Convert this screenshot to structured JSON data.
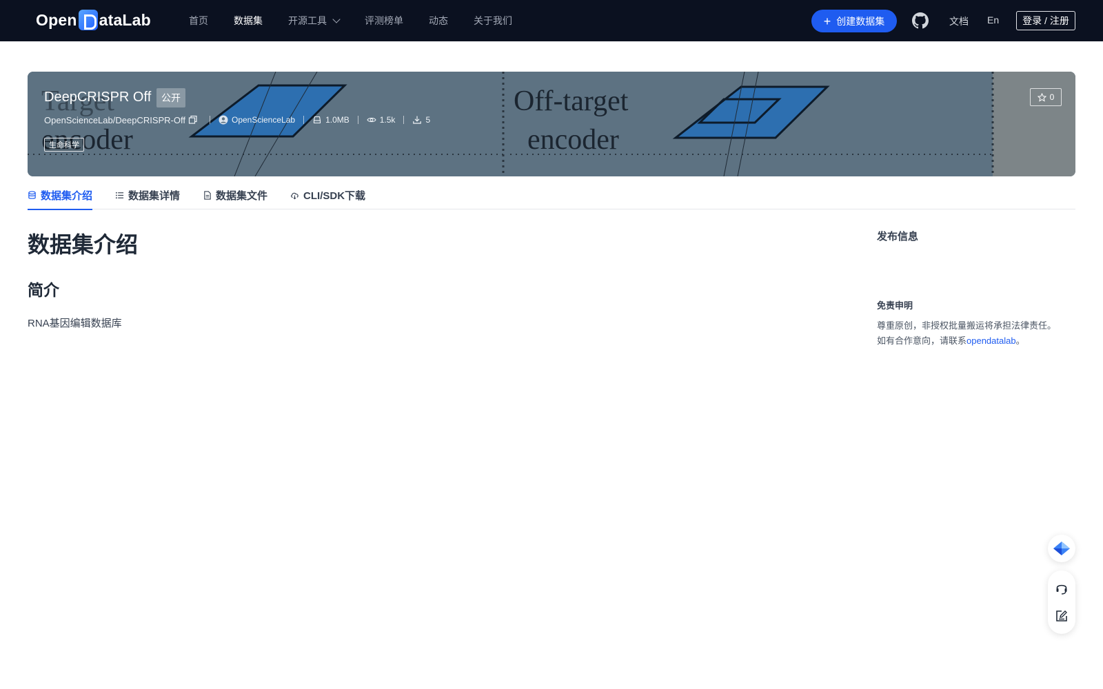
{
  "brand": {
    "logo_text_left": "Open",
    "logo_text_right": "ataLab"
  },
  "nav": {
    "items": [
      {
        "label": "首页"
      },
      {
        "label": "数据集"
      },
      {
        "label": "开源工具"
      },
      {
        "label": "评测榜单"
      },
      {
        "label": "动态"
      },
      {
        "label": "关于我们"
      }
    ],
    "create_label": "创建数据集",
    "docs_label": "文档",
    "lang_label": "En",
    "login_label": "登录 / 注册"
  },
  "dataset": {
    "title": "DeepCRISPR Off",
    "visibility": "公开",
    "repo_path": "OpenScienceLab/DeepCRISPR-Off",
    "publisher": "OpenScienceLab",
    "size": "1.0MB",
    "views": "1.5k",
    "downloads": "5",
    "field_tag": "生命科学",
    "stars": "0",
    "banner_text": [
      "Target",
      "encoder",
      "Off-target",
      "encoder"
    ]
  },
  "tabs": [
    {
      "label": "数据集介绍",
      "icon": "database-icon"
    },
    {
      "label": "数据集详情",
      "icon": "list-icon"
    },
    {
      "label": "数据集文件",
      "icon": "file-icon"
    },
    {
      "label": "CLI/SDK下载",
      "icon": "cloud-download-icon"
    }
  ],
  "content": {
    "heading": "数据集介绍",
    "subheading": "简介",
    "description": "RNA基因编辑数据库"
  },
  "sidebar": {
    "publish_title": "发布信息",
    "disclaimer_title": "免责申明",
    "disclaimer_line1": "尊重原创，非授权批量搬运将承担法律责任。",
    "disclaimer_line2_prefix": "如有合作意向，请联系",
    "disclaimer_link": "opendatalab",
    "disclaimer_line2_suffix": "。"
  },
  "colors": {
    "nav_bg": "#0b1120",
    "accent": "#1f5cf0",
    "banner_bg": "#5a6e7d"
  }
}
